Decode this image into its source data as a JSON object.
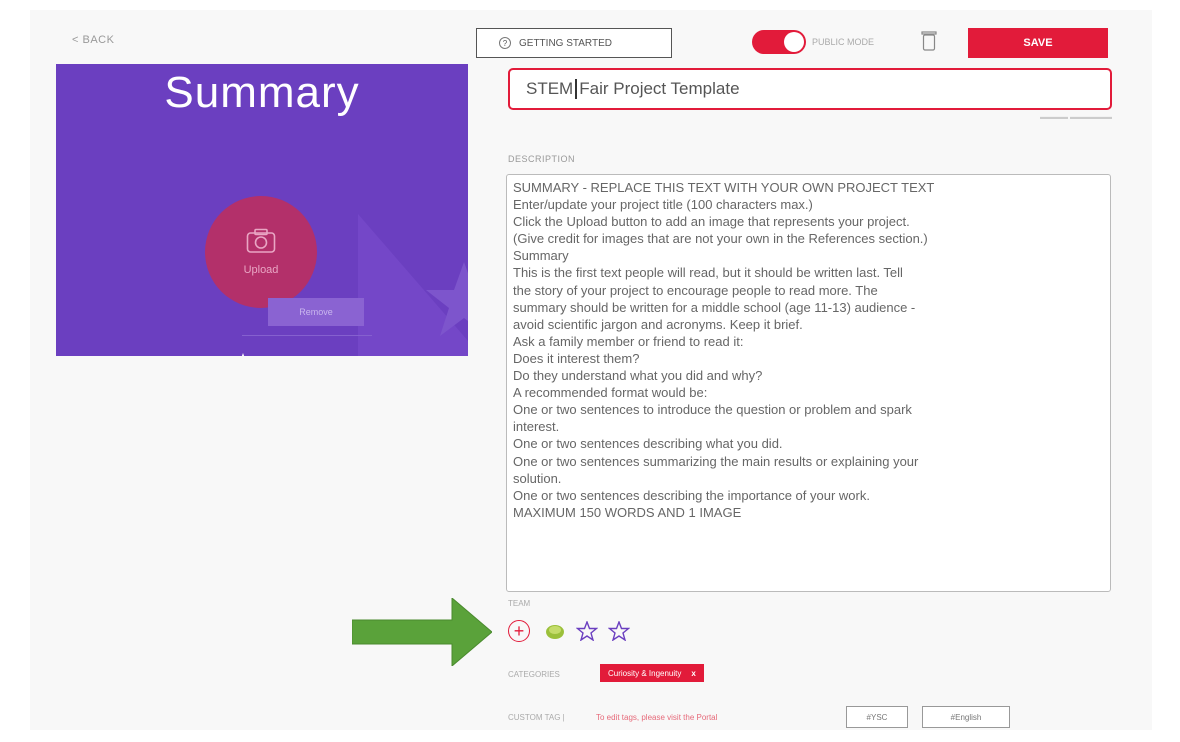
{
  "nav": {
    "back_label": "< BACK"
  },
  "toolbar": {
    "getting_started_label": "GETTING STARTED",
    "public_label": "PUBLIC MODE",
    "save_label": "SAVE",
    "public_mode_on": true
  },
  "cover": {
    "title": "Summary",
    "upload_label": "Upload",
    "remove_label": "Remove"
  },
  "project": {
    "title_before_cursor": "STEM",
    "title_after_cursor": "Fair Project Template"
  },
  "description": {
    "label": "DESCRIPTION",
    "lines": [
      "SUMMARY - REPLACE THIS TEXT WITH YOUR OWN PROJECT TEXT",
      "Enter/update your project title (100 characters max.)",
      "Click the Upload button to add an image that represents your project.",
      "(Give credit for images that are not your own in the References section.)",
      "Summary",
      "This is the first text  people will read, but it should be written last. Tell",
      "the story of your project to encourage people to read more. The",
      "summary should be written for a middle school (age 11-13) audience -",
      "avoid scientific jargon and acronyms. Keep it brief.",
      "Ask a family member or friend to read it:",
      "Does it interest them?",
      "Do they understand what you did and why?",
      "A recommended format would be:",
      "One or two sentences to introduce the question or problem and spark",
      "interest.",
      "One or two sentences describing what you did.",
      "One or two sentences summarizing the main results or explaining your",
      "solution.",
      "One or two sentences describing the importance of your work.",
      "MAXIMUM 150 WORDS AND 1 IMAGE"
    ]
  },
  "team": {
    "label": "TEAM",
    "add_icon": "plus-circle-icon",
    "members": [
      "avatar-icon",
      "star-icon",
      "star-icon"
    ]
  },
  "categories": {
    "label": "CATEGORIES",
    "tags": [
      {
        "label": "Curiosity & Ingenuity",
        "remove": "x"
      }
    ]
  },
  "custom_tags": {
    "label": "CUSTOM TAG |",
    "hint": "To edit tags, please visit the Portal",
    "tags": [
      "#YSC",
      "#English"
    ]
  },
  "colors": {
    "accent": "#e21b3a",
    "cover_bg": "#6b3fc0",
    "arrow": "#5aa23a"
  }
}
